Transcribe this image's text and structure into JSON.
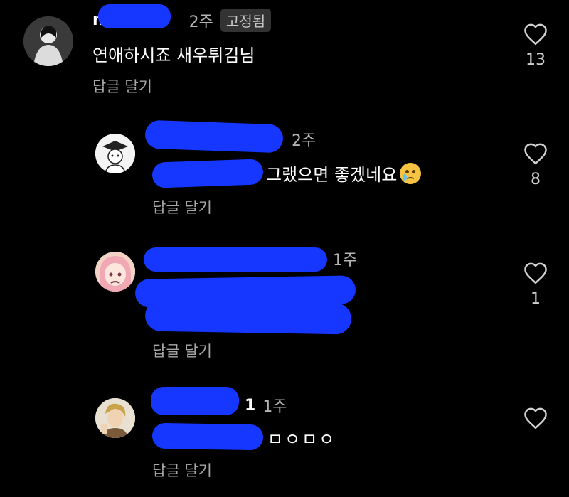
{
  "colors": {
    "background": "#000000",
    "redaction": "#1537ff",
    "meta_text": "#b5b5b5",
    "reply_link": "#a8a8a8"
  },
  "comments": [
    {
      "username_visible": "n",
      "time": "2주",
      "badge": "고정됨",
      "text": "연애하시죠 새우튀김님",
      "reply_label": "답글 달기",
      "like_icon": "heart-outline-icon",
      "like_count": "13"
    },
    {
      "username_visible": "",
      "time": "2주",
      "text": "그랬으면 좋겠네요",
      "emoji": "crying-face-emoji",
      "reply_label": "답글 달기",
      "like_icon": "heart-outline-icon",
      "like_count": "8"
    },
    {
      "username_visible": "",
      "time": "1주",
      "text": "",
      "reply_label": "답글 달기",
      "like_icon": "heart-outline-icon",
      "like_count": "1"
    },
    {
      "username_visible": "1",
      "time": "1주",
      "text": "ㅁㅇㅁㅇ",
      "reply_label": "답글 달기",
      "like_icon": "heart-outline-icon",
      "like_count": ""
    }
  ]
}
